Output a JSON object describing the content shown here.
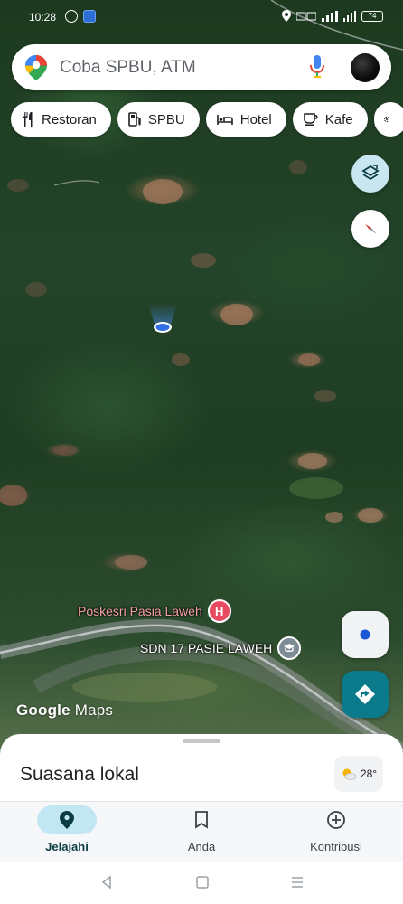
{
  "status_bar": {
    "time": "10:28",
    "battery": "74"
  },
  "search": {
    "placeholder": "Coba SPBU, ATM"
  },
  "chips": [
    {
      "label": "Restoran",
      "icon": "restaurant-icon"
    },
    {
      "label": "SPBU",
      "icon": "gas-station-icon"
    },
    {
      "label": "Hotel",
      "icon": "hotel-icon"
    },
    {
      "label": "Kafe",
      "icon": "cafe-icon"
    }
  ],
  "map": {
    "type": "satellite",
    "pois": [
      {
        "name": "Poskesri Pasia Laweh",
        "icon": "hospital-icon",
        "badge": "H"
      },
      {
        "name": "SDN 17 PASIE LAWEH",
        "icon": "school-icon"
      }
    ],
    "attribution_brand": "Google",
    "attribution_product": "Maps"
  },
  "sheet": {
    "title": "Suasana lokal",
    "temperature": "28°"
  },
  "nav": {
    "items": [
      {
        "label": "Jelajahi",
        "icon": "explore-pin-icon",
        "active": true
      },
      {
        "label": "Anda",
        "icon": "bookmark-icon",
        "active": false
      },
      {
        "label": "Kontribusi",
        "icon": "add-circle-icon",
        "active": false
      }
    ]
  },
  "colors": {
    "accent": "#0b7a8a",
    "active_nav": "#c2e7f2",
    "layers_button": "#c7e6ef",
    "hospital": "#e84a5f"
  }
}
